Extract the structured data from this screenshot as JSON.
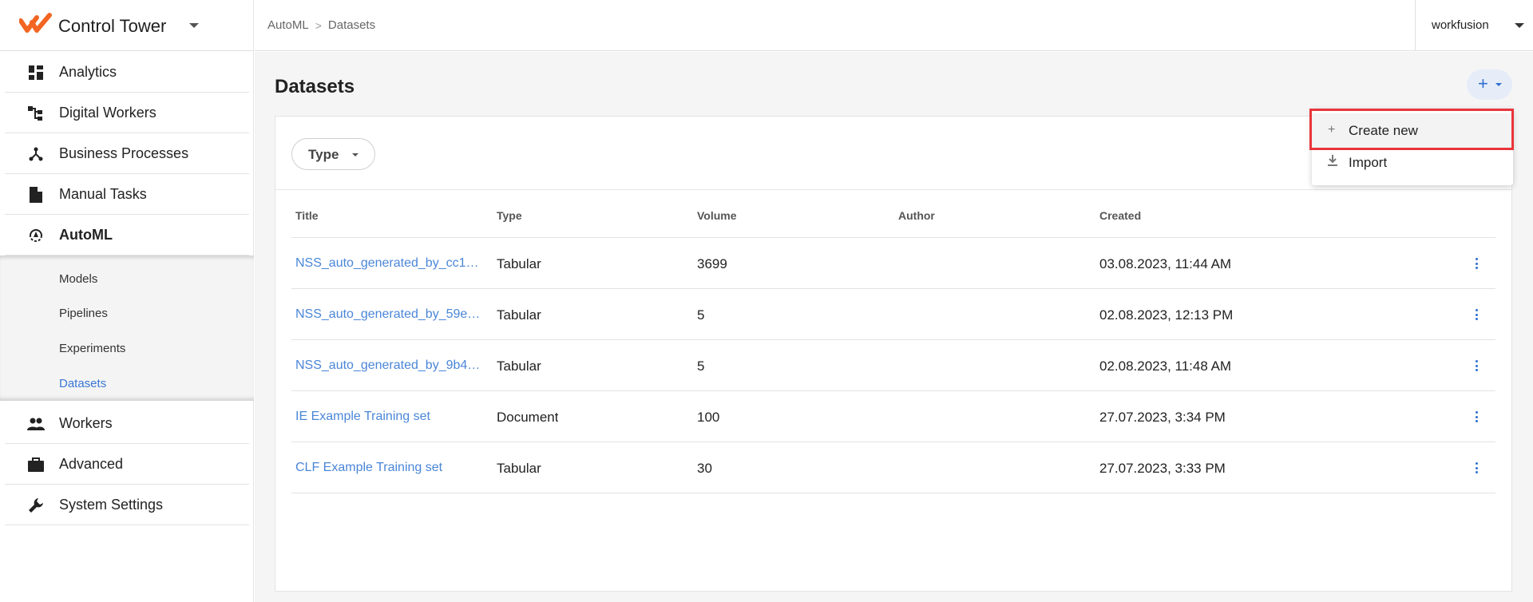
{
  "brand": {
    "title": "Control Tower",
    "accent": "#f26522"
  },
  "sidebar": {
    "items": [
      {
        "label": "Analytics",
        "icon": "dashboard-icon"
      },
      {
        "label": "Digital Workers",
        "icon": "org-chart-icon"
      },
      {
        "label": "Business Processes",
        "icon": "process-icon"
      },
      {
        "label": "Manual Tasks",
        "icon": "document-icon"
      },
      {
        "label": "AutoML",
        "icon": "automl-icon"
      },
      {
        "label": "Workers",
        "icon": "people-icon"
      },
      {
        "label": "Advanced",
        "icon": "briefcase-icon"
      },
      {
        "label": "System Settings",
        "icon": "wrench-icon"
      }
    ],
    "automl_sub": [
      "Models",
      "Pipelines",
      "Experiments",
      "Datasets"
    ]
  },
  "topbar": {
    "breadcrumb": [
      "AutoML",
      "Datasets"
    ],
    "user": "workfusion"
  },
  "page": {
    "title": "Datasets"
  },
  "filters": {
    "type_label": "Type"
  },
  "table": {
    "headers": [
      "Title",
      "Type",
      "Volume",
      "Author",
      "Created"
    ],
    "rows": [
      {
        "title": "NSS_auto_generated_by_cc1…",
        "type": "Tabular",
        "volume": "3699",
        "author": "",
        "created": "03.08.2023, 11:44 AM"
      },
      {
        "title": "NSS_auto_generated_by_59e…",
        "type": "Tabular",
        "volume": "5",
        "author": "",
        "created": "02.08.2023, 12:13 PM"
      },
      {
        "title": "NSS_auto_generated_by_9b4…",
        "type": "Tabular",
        "volume": "5",
        "author": "",
        "created": "02.08.2023, 11:48 AM"
      },
      {
        "title": "IE Example Training set",
        "type": "Document",
        "volume": "100",
        "author": "",
        "created": "27.07.2023, 3:34 PM"
      },
      {
        "title": "CLF Example Training set",
        "type": "Tabular",
        "volume": "30",
        "author": "",
        "created": "27.07.2023, 3:33 PM"
      }
    ]
  },
  "dropdown": {
    "items": [
      {
        "label": "Create new",
        "icon": "plus-icon"
      },
      {
        "label": "Import",
        "icon": "download-icon"
      }
    ]
  },
  "colors": {
    "link": "#4a86d8",
    "primary": "#2f6fd1",
    "highlight": "#e8353a"
  }
}
